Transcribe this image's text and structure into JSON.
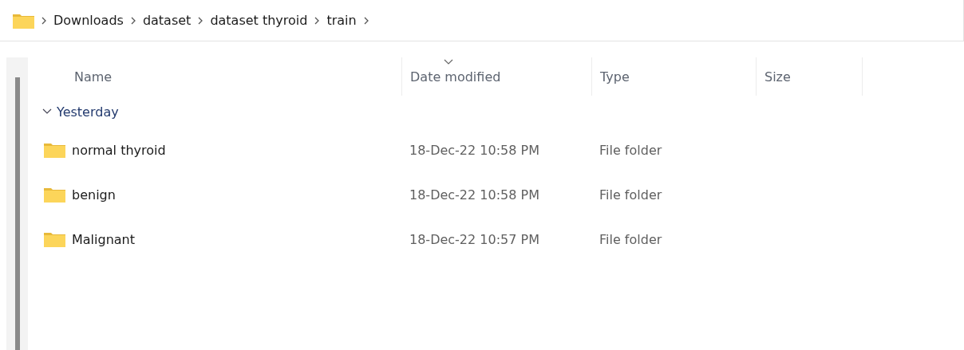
{
  "breadcrumb": [
    "Downloads",
    "dataset",
    "dataset thyroid",
    "train"
  ],
  "columns": [
    {
      "label": "Name",
      "sorted": false
    },
    {
      "label": "Date modified",
      "sorted": true
    },
    {
      "label": "Type",
      "sorted": false
    },
    {
      "label": "Size",
      "sorted": false
    }
  ],
  "groups": [
    {
      "label": "Yesterday",
      "expanded": true,
      "rows": [
        {
          "name": "normal thyroid",
          "date": "18-Dec-22 10:58 PM",
          "type": "File folder"
        },
        {
          "name": "benign",
          "date": "18-Dec-22 10:58 PM",
          "type": "File folder"
        },
        {
          "name": "Malignant",
          "date": "18-Dec-22 10:57 PM",
          "type": "File folder"
        }
      ]
    }
  ]
}
